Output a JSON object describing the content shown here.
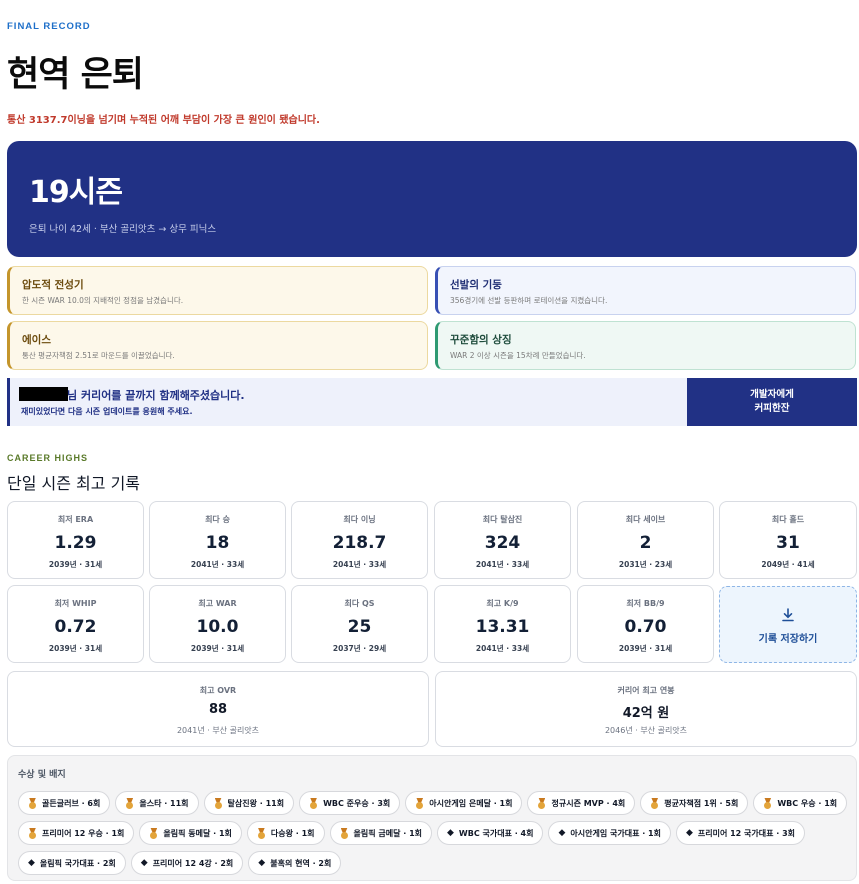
{
  "header": {
    "eyebrow": "FINAL RECORD",
    "title": "현역 은퇴",
    "reason": "통산 3137.7이닝을 넘기며 누적된 어깨 부담이 가장 큰 원인이 됐습니다."
  },
  "hero": {
    "seasons": "19시즌",
    "subtitle": "은퇴 나이 42세 · 부산 골리앗츠 → 상무 피닉스"
  },
  "traits": [
    {
      "title": "압도적 전성기",
      "desc": "한 시즌 WAR 10.0의 지배적인 정점을 남겼습니다.",
      "style": "gold"
    },
    {
      "title": "선발의 기둥",
      "desc": "356경기에 선발 등판하며 로테이션을 지켰습니다.",
      "style": "blue"
    },
    {
      "title": "에이스",
      "desc": "통산 평균자책점 2.51로 마운드를 이끌었습니다.",
      "style": "gold"
    },
    {
      "title": "꾸준함의 상징",
      "desc": "WAR 2 이상 시즌을 15차례 만들었습니다.",
      "style": "green"
    }
  ],
  "banner": {
    "main": "님 커리어를 끝까지 함께해주셨습니다.",
    "sub": "재미있었다면 다음 시즌 업데이트를 응원해 주세요.",
    "button_line1": "개발자에게",
    "button_line2": "커피한잔"
  },
  "career": {
    "eyebrow": "CAREER HIGHS",
    "title": "단일 시즌 최고 기록",
    "stats": [
      {
        "label": "최저 ERA",
        "value": "1.29",
        "meta": "2039년 · 31세"
      },
      {
        "label": "최다 승",
        "value": "18",
        "meta": "2041년 · 33세"
      },
      {
        "label": "최다 이닝",
        "value": "218.7",
        "meta": "2041년 · 33세"
      },
      {
        "label": "최다 탈삼진",
        "value": "324",
        "meta": "2041년 · 33세"
      },
      {
        "label": "최다 세이브",
        "value": "2",
        "meta": "2031년 · 23세"
      },
      {
        "label": "최다 홀드",
        "value": "31",
        "meta": "2049년 · 41세"
      },
      {
        "label": "최저 WHIP",
        "value": "0.72",
        "meta": "2039년 · 31세"
      },
      {
        "label": "최고 WAR",
        "value": "10.0",
        "meta": "2039년 · 31세"
      },
      {
        "label": "최다 QS",
        "value": "25",
        "meta": "2037년 · 29세"
      },
      {
        "label": "최고 K/9",
        "value": "13.31",
        "meta": "2041년 · 33세"
      },
      {
        "label": "최저 BB/9",
        "value": "0.70",
        "meta": "2039년 · 31세"
      }
    ],
    "save_label": "기록 저장하기",
    "ovr": {
      "label": "최고 OVR",
      "value": "88",
      "meta": "2041년 · 부산 골리앗츠"
    },
    "salary": {
      "label": "커리어 최고 연봉",
      "value": "42억 원",
      "meta": "2046년 · 부산 골리앗츠"
    }
  },
  "awards": {
    "title": "수상 및 배지",
    "rows": [
      [
        {
          "icon": "medal",
          "label": "골든글러브 · 6회"
        },
        {
          "icon": "medal",
          "label": "올스타 · 11회"
        },
        {
          "icon": "medal",
          "label": "탈삼진왕 · 11회"
        },
        {
          "icon": "medal",
          "label": "WBC 준우승 · 3회"
        },
        {
          "icon": "medal",
          "label": "아시안게임 은메달 · 1회"
        },
        {
          "icon": "medal",
          "label": "정규시즌 MVP · 4회"
        },
        {
          "icon": "medal",
          "label": "평균자책점 1위 · 5회"
        },
        {
          "icon": "medal",
          "label": "WBC 우승 · 1회"
        }
      ],
      [
        {
          "icon": "medal",
          "label": "프리미어 12 우승 · 1회"
        },
        {
          "icon": "medal",
          "label": "올림픽 동메달 · 1회"
        },
        {
          "icon": "medal",
          "label": "다승왕 · 1회"
        },
        {
          "icon": "medal",
          "label": "올림픽 금메달 · 1회"
        },
        {
          "icon": "diamond",
          "label": "WBC 국가대표 · 4회"
        },
        {
          "icon": "diamond",
          "label": "아시안게임 국가대표 · 1회"
        },
        {
          "icon": "diamond",
          "label": "프리미어 12 국가대표 · 3회"
        }
      ],
      [
        {
          "icon": "diamond",
          "label": "올림픽 국가대표 · 2회"
        },
        {
          "icon": "diamond",
          "label": "프리미어 12 4강 · 2회"
        },
        {
          "icon": "diamond",
          "label": "불혹의 현역 · 2회"
        }
      ]
    ]
  },
  "colors": {
    "navy": "#213185",
    "accent_red": "#c0392b",
    "eyebrow_blue": "#1e6fc9",
    "eyebrow_green": "#5a7a2a"
  }
}
